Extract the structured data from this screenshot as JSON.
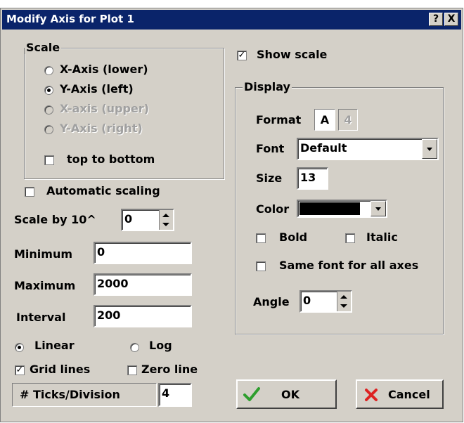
{
  "window": {
    "title": "Modify Axis for Plot 1",
    "help_label": "?",
    "close_label": "X"
  },
  "scale": {
    "group_title": "Scale",
    "options": [
      {
        "label": "X-Axis (lower)",
        "selected": false,
        "enabled": true
      },
      {
        "label": "Y-Axis (left)",
        "selected": true,
        "enabled": true
      },
      {
        "label": "X-axis (upper)",
        "selected": false,
        "enabled": false
      },
      {
        "label": "Y-Axis (right)",
        "selected": false,
        "enabled": false
      }
    ],
    "top_to_bottom": {
      "label": "top to bottom",
      "checked": false
    }
  },
  "automatic_scaling": {
    "label": "Automatic scaling",
    "checked": false
  },
  "scale_by": {
    "label": "Scale by 10^",
    "value": "0"
  },
  "minimum": {
    "label": "Minimum",
    "value": "0"
  },
  "maximum": {
    "label": "Maximum",
    "value": "2000"
  },
  "interval": {
    "label": "Interval",
    "value": "200"
  },
  "linear": {
    "label": "Linear",
    "selected": true
  },
  "log": {
    "label": "Log",
    "selected": false
  },
  "grid_lines": {
    "label": "Grid lines",
    "checked": true
  },
  "zero_line": {
    "label": "Zero line",
    "checked": false
  },
  "ticks": {
    "label": "# Ticks/Division",
    "value": "4"
  },
  "show_scale": {
    "label": "Show scale",
    "checked": true
  },
  "display": {
    "group_title": "Display",
    "format_label": "Format",
    "format_a": "A",
    "format_4": "4",
    "font_label": "Font",
    "font_value": "Default",
    "size_label": "Size",
    "size_value": "13",
    "color_label": "Color",
    "color_value": "#000000",
    "bold": {
      "label": "Bold",
      "checked": false
    },
    "italic": {
      "label": "Italic",
      "checked": false
    },
    "same_font": {
      "label": "Same font for all axes",
      "checked": false
    },
    "angle_label": "Angle",
    "angle_value": "0"
  },
  "buttons": {
    "ok_label": "OK",
    "cancel_label": "Cancel"
  }
}
